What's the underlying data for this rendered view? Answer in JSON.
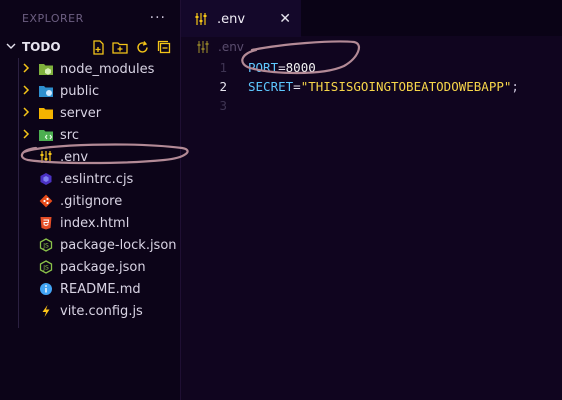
{
  "sidebar": {
    "header_title": "EXPLORER",
    "more_label": "···",
    "root_label": "TODO",
    "items": [
      {
        "label": "node_modules",
        "type": "folder",
        "icon": "node-folder-icon"
      },
      {
        "label": "public",
        "type": "folder",
        "icon": "public-folder-icon"
      },
      {
        "label": "server",
        "type": "folder",
        "icon": "folder-icon"
      },
      {
        "label": "src",
        "type": "folder",
        "icon": "src-folder-icon"
      },
      {
        "label": ".env",
        "type": "file",
        "icon": "env-icon"
      },
      {
        "label": ".eslintrc.cjs",
        "type": "file",
        "icon": "eslint-icon"
      },
      {
        "label": ".gitignore",
        "type": "file",
        "icon": "git-icon"
      },
      {
        "label": "index.html",
        "type": "file",
        "icon": "html-icon"
      },
      {
        "label": "package-lock.json",
        "type": "file",
        "icon": "node-file-icon"
      },
      {
        "label": "package.json",
        "type": "file",
        "icon": "node-file-icon"
      },
      {
        "label": "README.md",
        "type": "file",
        "icon": "info-icon"
      },
      {
        "label": "vite.config.js",
        "type": "file",
        "icon": "vite-icon"
      }
    ]
  },
  "tab": {
    "label": ".env",
    "close": "✕"
  },
  "breadcrumb": {
    "label": ".env"
  },
  "editor": {
    "lines": [
      {
        "num": "1",
        "key": "PORT",
        "eq": "=",
        "value": "8000",
        "semi": ""
      },
      {
        "num": "2",
        "key": "SECRET",
        "eq": "=",
        "value": "\"THISISGOINGTOBEATODOWEBAPP\"",
        "semi": ";"
      },
      {
        "num": "3",
        "key": "",
        "eq": "",
        "value": "",
        "semi": ""
      }
    ]
  },
  "colors": {
    "background": "#10051f",
    "key": "#5ec8ff",
    "string": "#f7d64a",
    "annotation": "#b38a96"
  }
}
